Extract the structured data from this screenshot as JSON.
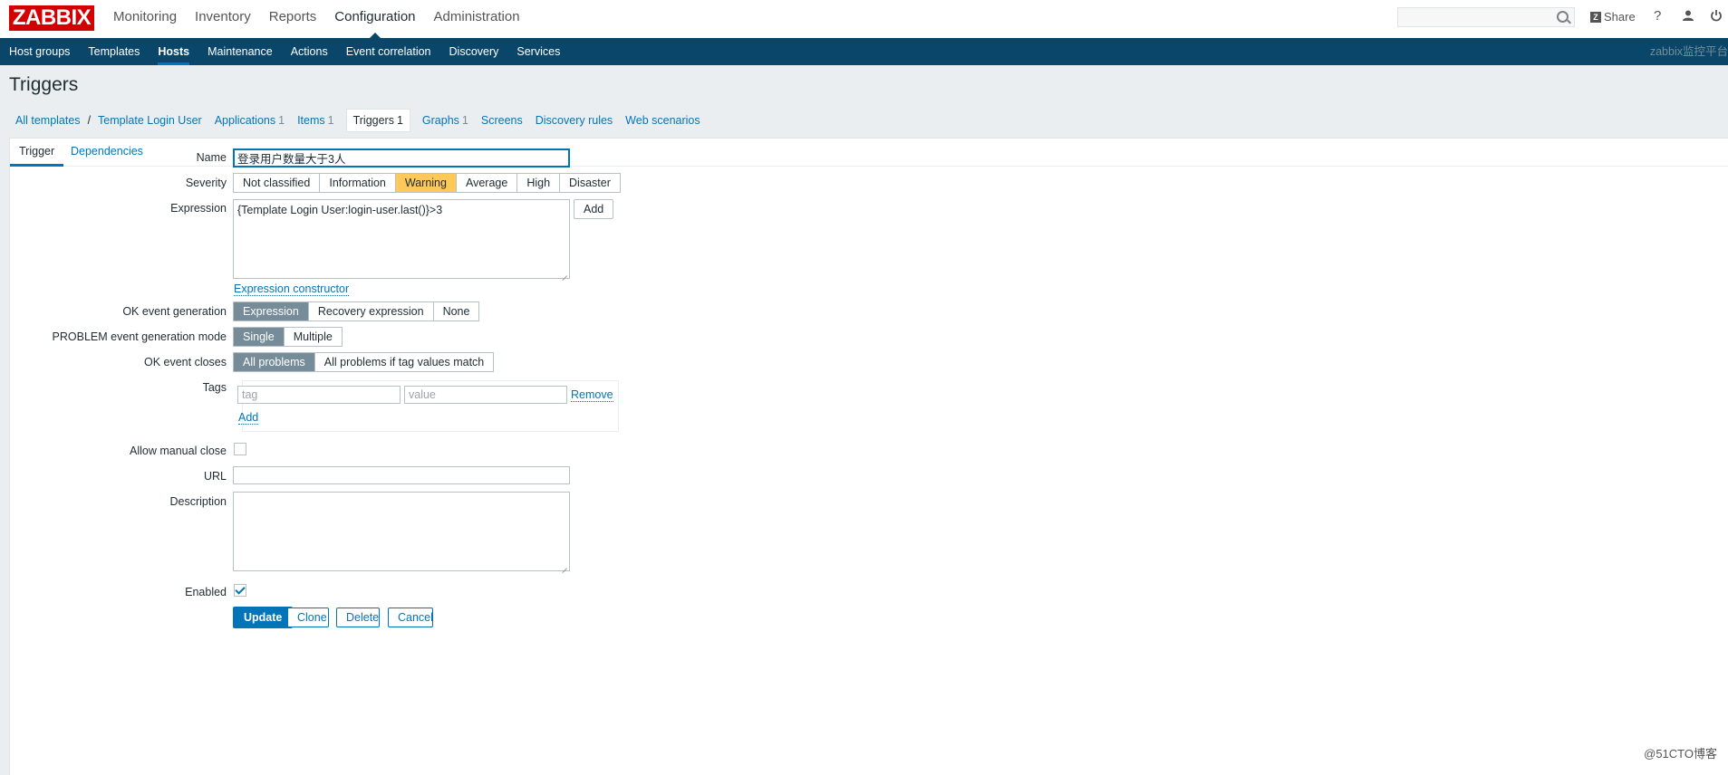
{
  "header": {
    "logo": "ZABBIX",
    "main_menu": [
      "Monitoring",
      "Inventory",
      "Reports",
      "Configuration",
      "Administration"
    ],
    "active_main": "Configuration",
    "search_placeholder": "",
    "share_label": "Share",
    "help_icon": "?",
    "icons": [
      "search-icon",
      "share-icon",
      "help-icon",
      "user-icon",
      "power-icon"
    ]
  },
  "submenu": {
    "items": [
      "Host groups",
      "Templates",
      "Hosts",
      "Maintenance",
      "Actions",
      "Event correlation",
      "Discovery",
      "Services"
    ],
    "active": "Hosts",
    "server_name": "zabbix监控平台"
  },
  "page": {
    "title": "Triggers"
  },
  "breadcrumb": {
    "all_templates": "All templates",
    "separator": "/",
    "template": "Template Login User",
    "applications": {
      "label": "Applications",
      "count": "1"
    },
    "items": {
      "label": "Items",
      "count": "1"
    },
    "triggers": {
      "label": "Triggers",
      "count": "1"
    },
    "graphs": {
      "label": "Graphs",
      "count": "1"
    },
    "screens": "Screens",
    "discovery_rules": "Discovery rules",
    "web_scenarios": "Web scenarios"
  },
  "tabs": {
    "trigger": "Trigger",
    "dependencies": "Dependencies"
  },
  "form": {
    "name": {
      "label": "Name",
      "value": "登录用户数量大于3人"
    },
    "severity": {
      "label": "Severity",
      "options": [
        "Not classified",
        "Information",
        "Warning",
        "Average",
        "High",
        "Disaster"
      ],
      "selected": "Warning"
    },
    "expression": {
      "label": "Expression",
      "value": "{Template Login User:login-user.last()}>3",
      "add_label": "Add",
      "constructor_link": "Expression constructor"
    },
    "ok_event_generation": {
      "label": "OK event generation",
      "options": [
        "Expression",
        "Recovery expression",
        "None"
      ],
      "selected": "Expression"
    },
    "problem_mode": {
      "label": "PROBLEM event generation mode",
      "options": [
        "Single",
        "Multiple"
      ],
      "selected": "Single"
    },
    "ok_event_closes": {
      "label": "OK event closes",
      "options": [
        "All problems",
        "All problems if tag values match"
      ],
      "selected": "All problems"
    },
    "tags": {
      "label": "Tags",
      "tag_placeholder": "tag",
      "value_placeholder": "value",
      "remove_label": "Remove",
      "add_label": "Add"
    },
    "allow_manual_close": {
      "label": "Allow manual close",
      "checked": false
    },
    "url": {
      "label": "URL",
      "value": ""
    },
    "description": {
      "label": "Description",
      "value": ""
    },
    "enabled": {
      "label": "Enabled",
      "checked": true
    },
    "buttons": {
      "update": "Update",
      "clone": "Clone",
      "delete": "Delete",
      "cancel": "Cancel"
    }
  },
  "watermark": "@51CTO博客",
  "colors": {
    "header_blue": "#0a466a",
    "link_blue": "#0275b8",
    "warning": "#ffc859",
    "selected_gray": "#768d99",
    "logo_red": "#d40000"
  }
}
